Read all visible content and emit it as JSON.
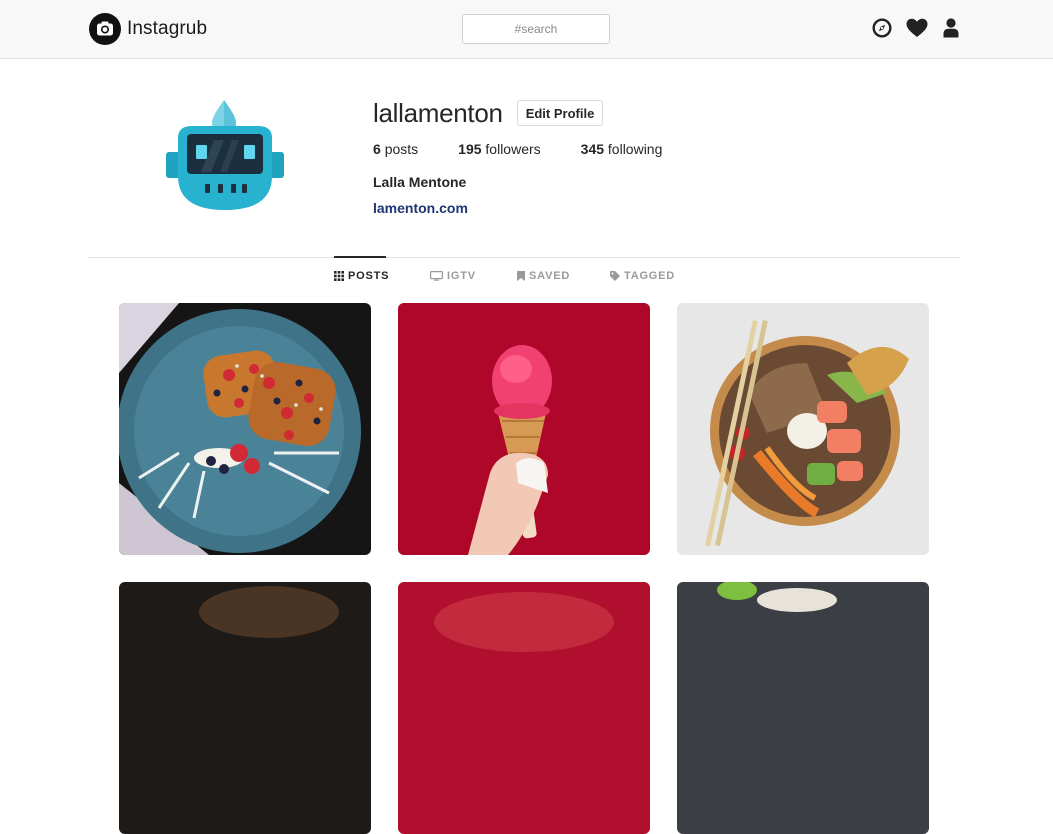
{
  "header": {
    "brand": "Instagrub",
    "search_placeholder": "#search",
    "icons": [
      "compass-icon",
      "heart-icon",
      "user-icon"
    ]
  },
  "profile": {
    "username": "lallamenton",
    "edit_button": "Edit Profile",
    "stats": [
      {
        "count": "6",
        "label": "posts"
      },
      {
        "count": "195",
        "label": "followers"
      },
      {
        "count": "345",
        "label": "following"
      }
    ],
    "full_name": "Lalla Mentone",
    "website": "lamenton.com"
  },
  "tabs": [
    {
      "label": "POSTS",
      "icon": "grid-icon",
      "active": true
    },
    {
      "label": "IGTV",
      "icon": "tv-icon",
      "active": false
    },
    {
      "label": "SAVED",
      "icon": "bookmark-icon",
      "active": false
    },
    {
      "label": "TAGGED",
      "icon": "tag-icon",
      "active": false
    }
  ],
  "colors": {
    "topbar_bg": "#f8f8f9",
    "link": "#203673",
    "avatar_teal": "#27b3cf",
    "post_red": "#b3082b"
  },
  "posts": [
    {
      "subject": "french-toast-plate"
    },
    {
      "subject": "ice-cream-cone"
    },
    {
      "subject": "poke-bowl"
    },
    {
      "subject": "dark-dish"
    },
    {
      "subject": "red-dish"
    },
    {
      "subject": "salad-bowl"
    }
  ]
}
